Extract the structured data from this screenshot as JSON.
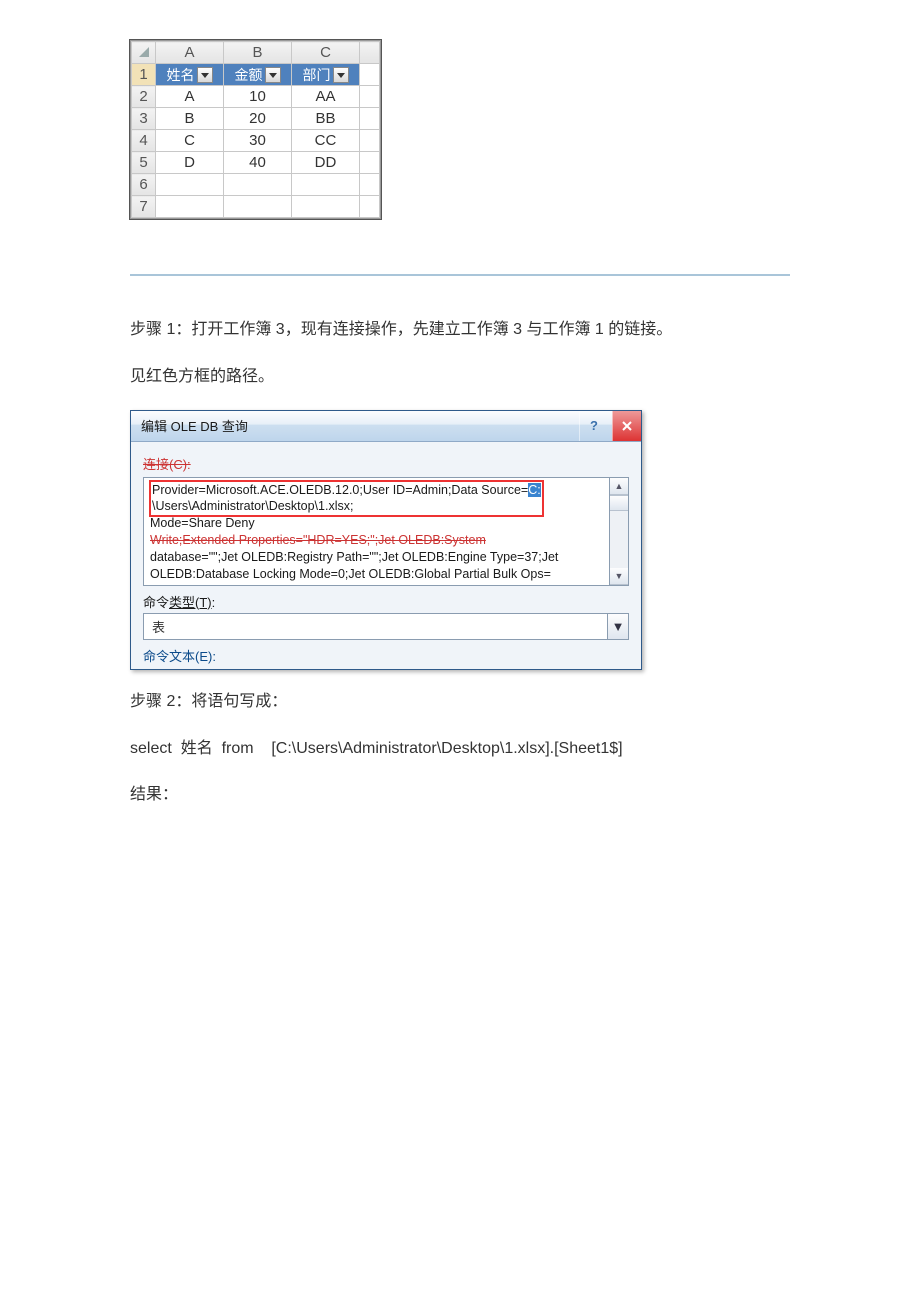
{
  "excel": {
    "col_headers": [
      "A",
      "B",
      "C"
    ],
    "row_headers": [
      "1",
      "2",
      "3",
      "4",
      "5",
      "6",
      "7"
    ],
    "filter_labels": [
      "姓名",
      "金额",
      "部门"
    ],
    "rows": [
      [
        "A",
        "10",
        "AA"
      ],
      [
        "B",
        "20",
        "BB"
      ],
      [
        "C",
        "30",
        "CC"
      ],
      [
        "D",
        "40",
        "DD"
      ]
    ]
  },
  "step1_text": "步骤 1：打开工作簿 3，现有连接操作，先建立工作簿 3 与工作簿 1 的链接。",
  "step1_note": "见红色方框的路径。",
  "dialog": {
    "title": "编辑 OLE DB 查询",
    "connection_label": "连接(C):",
    "conn_line1_a": "Provider=Microsoft.ACE.OLEDB.12.0;User ID=Admin;Data Source=",
    "conn_line1_hl": "C:",
    "conn_line2": "\\Users\\Administrator\\Desktop\\1.xlsx;",
    "conn_line2_b": "Mode=Share Deny",
    "conn_line3_strike": "Write;Extended Properties=\"HDR=YES;\";Jet OLEDB:System",
    "conn_line4": "database=\"\";Jet OLEDB:Registry Path=\"\";Jet OLEDB:Engine Type=37;Jet",
    "conn_line5": "OLEDB:Database Locking Mode=0;Jet OLEDB:Global Partial Bulk Ops=",
    "command_type_label_a": "命令",
    "command_type_label_u": "类型(T)",
    "command_type_label_b": ":",
    "command_type_value": "表",
    "command_text_label": "命令文本(E):"
  },
  "step2_text": "步骤 2：将语句写成：",
  "sql_text": "select  姓名  from    [C:\\Users\\Administrator\\Desktop\\1.xlsx].[Sheet1$]",
  "result_label": "结果："
}
